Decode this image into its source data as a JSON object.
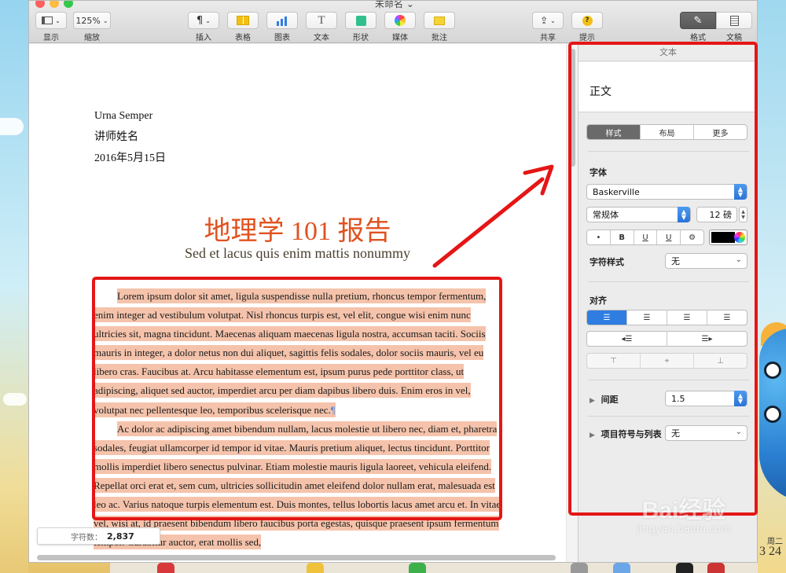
{
  "window": {
    "title": "未命名 ⌄"
  },
  "toolbar": {
    "view": {
      "label": "显示"
    },
    "zoom": {
      "value": "125%",
      "label": "缩放"
    },
    "insert": {
      "label": "插入"
    },
    "table": {
      "label": "表格"
    },
    "chart": {
      "label": "图表"
    },
    "text": {
      "label": "文本"
    },
    "shape": {
      "label": "形状"
    },
    "media": {
      "label": "媒体"
    },
    "comment": {
      "label": "批注"
    },
    "share": {
      "label": "共享"
    },
    "tips": {
      "label": "提示"
    },
    "format": {
      "label": "格式"
    },
    "document": {
      "label": "文稿"
    }
  },
  "document": {
    "sender_name": "Urna Semper",
    "sender_title": "讲师姓名",
    "date": "2016年5月15日",
    "title": "地理学 101 报告",
    "subtitle": "Sed et lacus quis enim mattis nonummy",
    "paragraph1": "Lorem ipsum dolor sit amet, ligula suspendisse nulla pretium, rhoncus tempor fermentum, enim integer ad vestibulum volutpat. Nisl rhoncus turpis est, vel elit, congue wisi enim nunc ultricies sit, magna tincidunt. Maecenas aliquam maecenas ligula nostra, accumsan taciti. Sociis mauris in integer, a dolor netus non dui aliquet, sagittis felis sodales, dolor sociis mauris, vel eu libero cras. Faucibus at. Arcu habitasse elementum est, ipsum purus pede porttitor class, ut adipiscing, aliquet sed auctor, imperdiet arcu per diam dapibus libero duis. Enim eros in vel, volutpat nec pellentesque leo, temporibus scelerisque nec.",
    "pilcrow": "¶",
    "paragraph2": "Ac dolor ac adipiscing amet bibendum nullam, lacus molestie ut libero nec, diam et, pharetra sodales, feugiat ullamcorper id tempor id vitae. Mauris pretium aliquet, lectus tincidunt. Porttitor mollis imperdiet libero senectus pulvinar. Etiam molestie mauris ligula laoreet, vehicula eleifend. Repellat orci erat et, sem cum, ultricies sollicitudin amet eleifend dolor nullam erat, malesuada est leo ac. Varius natoque turpis elementum est. Duis montes, tellus lobortis lacus amet arcu et. In vitae vel, wisi at, id praesent bibendum libero faucibus porta egestas, quisque praesent ipsum fermentum tempor. Curabitur auctor, erat mollis sed,"
  },
  "status": {
    "word_count_label": "字符数：",
    "word_count_value": "2,837"
  },
  "inspector": {
    "header": "文本",
    "paragraph_style": "正文",
    "tabs": [
      "样式",
      "布局",
      "更多"
    ],
    "font_section": "字体",
    "font_family": "Baskerville",
    "font_weight": "常规体",
    "font_size": "12 磅",
    "format_buttons": [
      "•",
      "B",
      "U",
      "U",
      "⚙"
    ],
    "char_style_label": "字符样式",
    "char_style_value": "无",
    "alignment_section": "对齐",
    "spacing_label": "间距",
    "spacing_value": "1.5",
    "bullets_label": "项目符号与列表",
    "bullets_value": "无"
  },
  "watermark": {
    "brand": "Bai经验",
    "url": "jingyan.baidu.com"
  },
  "desktop_clock": {
    "weekday": "周二",
    "day": "3 24"
  },
  "colors": {
    "title_orange": "#e0521f",
    "selection": "#f5c3ab",
    "annotation_red": "#e51616",
    "accent_blue": "#2f7de1"
  }
}
